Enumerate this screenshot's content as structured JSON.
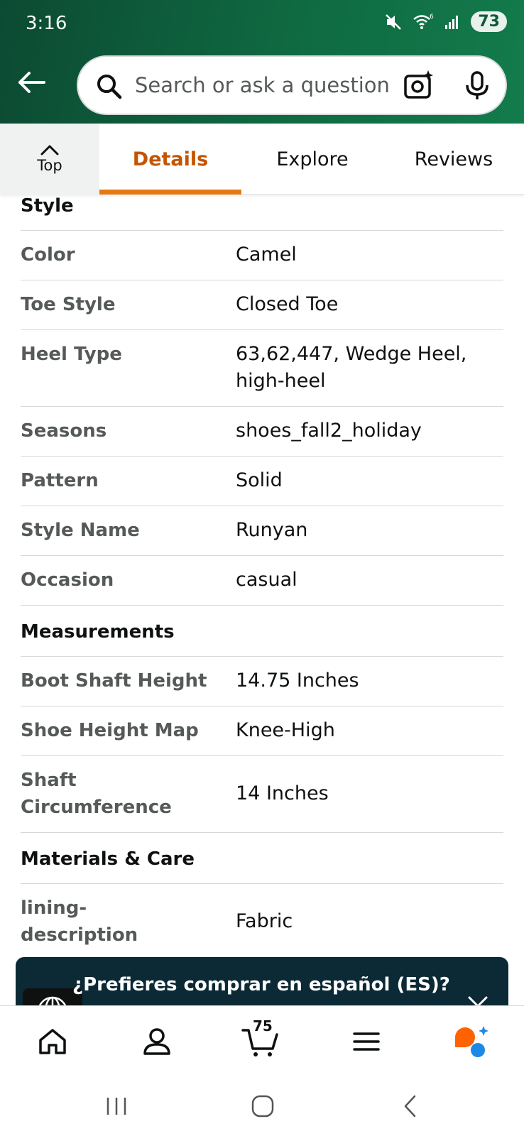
{
  "status_bar": {
    "time": "3:16",
    "battery": "73",
    "icons": [
      "mute-icon",
      "wifi-icon",
      "signal-icon"
    ]
  },
  "header": {
    "back_icon": "arrow-left-icon",
    "search_placeholder": "Search or ask a question",
    "icons": [
      "search-icon",
      "camera-sparkle-icon",
      "mic-icon"
    ]
  },
  "tabs": {
    "top_label": "Top",
    "items": [
      "Details",
      "Explore",
      "Reviews"
    ],
    "active": "Details"
  },
  "sections": [
    {
      "title": "Style",
      "rows": [
        {
          "key": "Color",
          "value": "Camel"
        },
        {
          "key": "Toe Style",
          "value": "Closed Toe"
        },
        {
          "key": "Heel Type",
          "value": "63,62,447, Wedge Heel, high-heel"
        },
        {
          "key": "Seasons",
          "value": "shoes_fall2_holiday"
        },
        {
          "key": "Pattern",
          "value": "Solid"
        },
        {
          "key": "Style Name",
          "value": "Runyan"
        },
        {
          "key": "Occasion",
          "value": "casual"
        }
      ]
    },
    {
      "title": "Measurements",
      "rows": [
        {
          "key": "Boot Shaft Height",
          "value": "14.75 Inches"
        },
        {
          "key": "Shoe Height Map",
          "value": "Knee-High"
        },
        {
          "key": "Shaft Circumference",
          "value": "14 Inches"
        }
      ]
    },
    {
      "title": "Materials & Care",
      "rows": [
        {
          "key": "lining-description",
          "value": "Fabric"
        }
      ]
    }
  ],
  "language_banner": {
    "text": "¿Prefieres comprar en español (ES)?"
  },
  "bottom_nav": {
    "cart_count": "75",
    "items": [
      "home-icon",
      "account-icon",
      "cart-icon",
      "menu-icon",
      "rufus-icon"
    ]
  },
  "colors": {
    "header_green": "#0f6a41",
    "tab_active": "#c45500",
    "tab_underline": "#e47911",
    "key_text": "#565959",
    "banner_bg": "#0b2a35",
    "rufus_orange": "#ff6200",
    "rufus_blue": "#1e88e5"
  }
}
